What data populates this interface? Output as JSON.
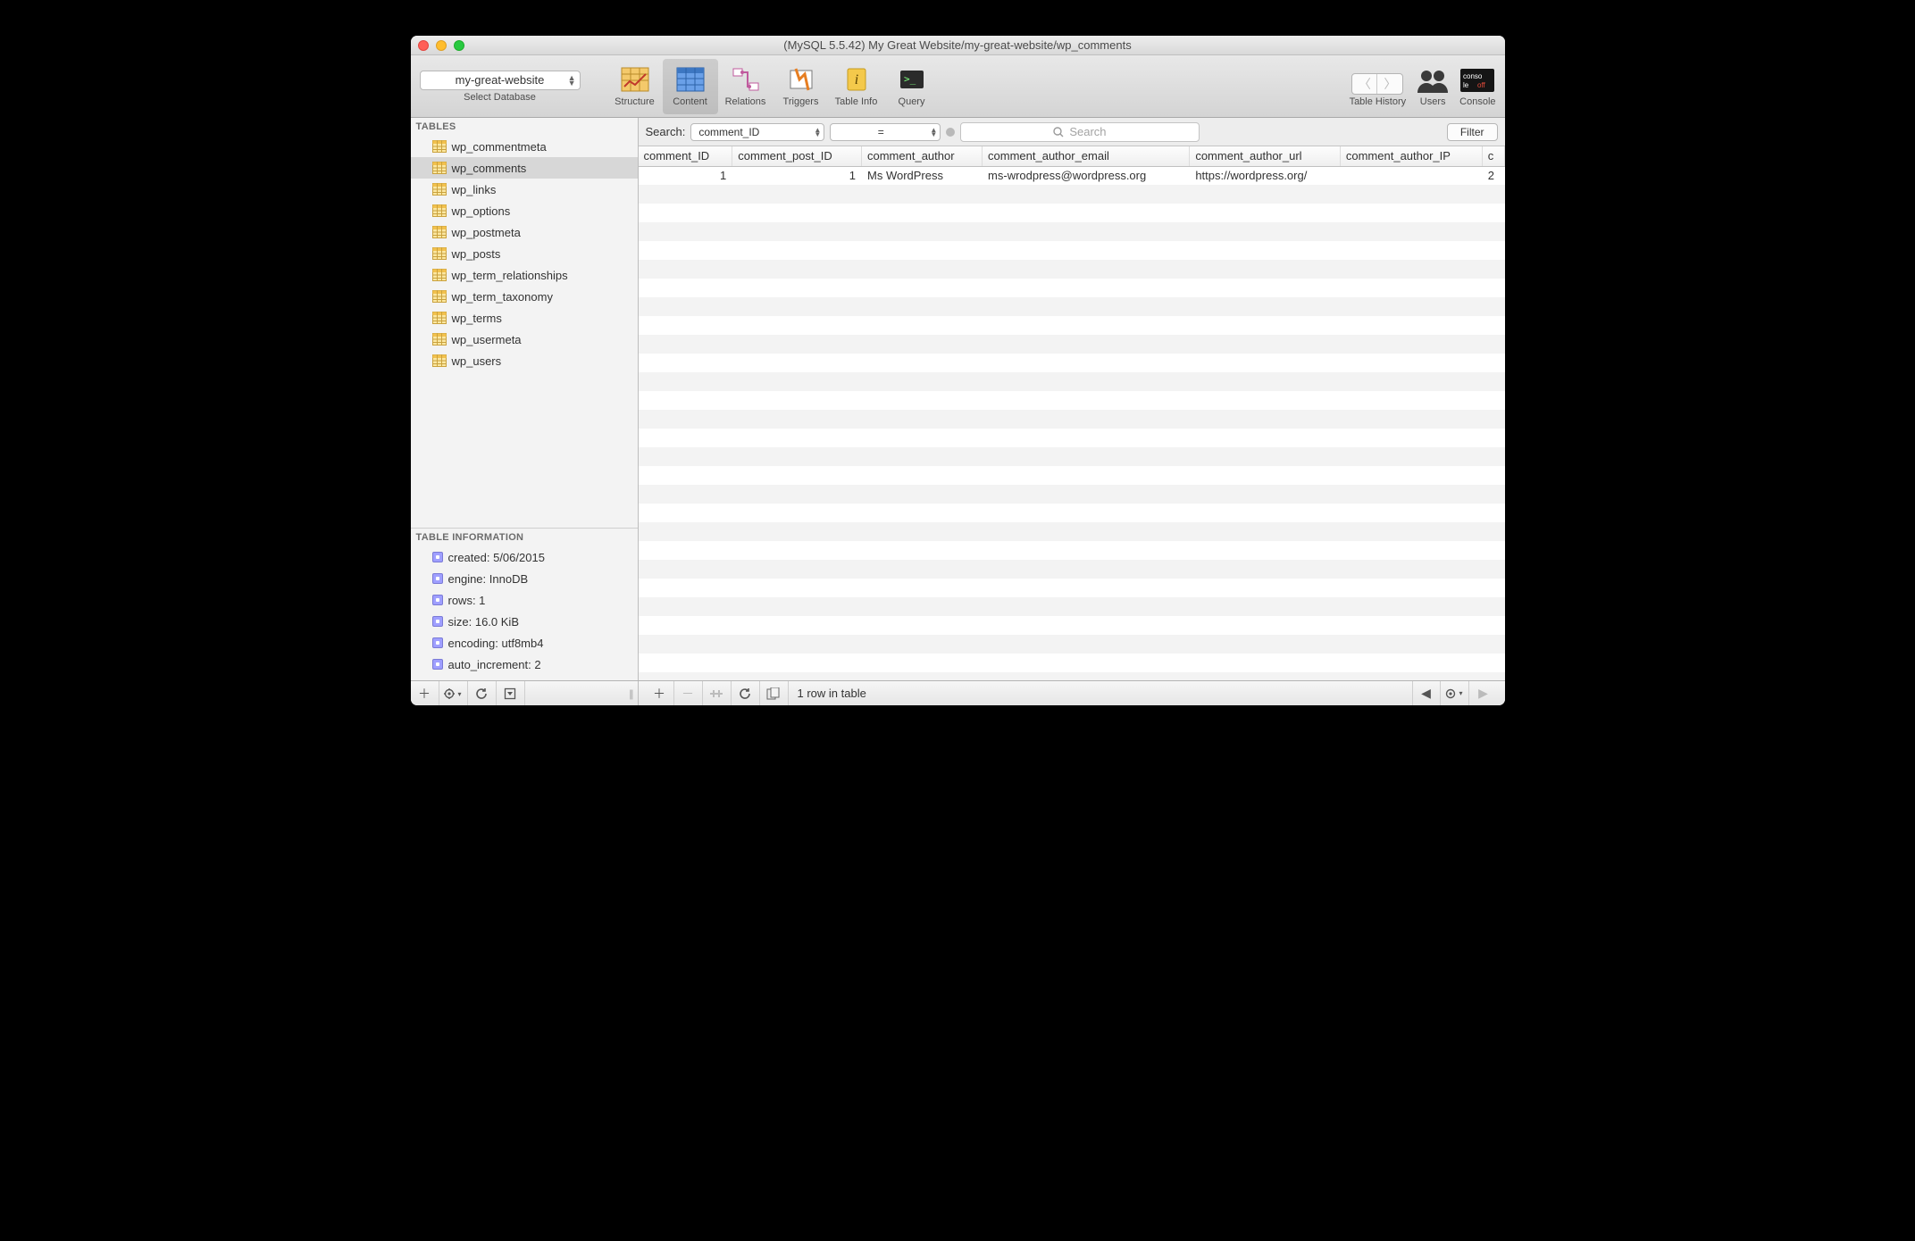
{
  "window": {
    "title": "(MySQL 5.5.42) My Great Website/my-great-website/wp_comments"
  },
  "toolbar": {
    "database": "my-great-website",
    "select_db_label": "Select Database",
    "tabs": {
      "structure": "Structure",
      "content": "Content",
      "relations": "Relations",
      "triggers": "Triggers",
      "table_info": "Table Info",
      "query": "Query"
    },
    "history_wrap_label": "Table History",
    "users_label": "Users",
    "console_label": "Console"
  },
  "sidebar": {
    "tables_header": "TABLES",
    "tables": [
      "wp_commentmeta",
      "wp_comments",
      "wp_links",
      "wp_options",
      "wp_postmeta",
      "wp_posts",
      "wp_term_relationships",
      "wp_term_taxonomy",
      "wp_terms",
      "wp_usermeta",
      "wp_users"
    ],
    "selected_table": "wp_comments",
    "info_header": "TABLE INFORMATION",
    "info": [
      "created: 5/06/2015",
      "engine: InnoDB",
      "rows: 1",
      "size: 16.0 KiB",
      "encoding: utf8mb4",
      "auto_increment: 2"
    ]
  },
  "search": {
    "label": "Search:",
    "field": "comment_ID",
    "operator": "=",
    "placeholder": "Search",
    "filter_label": "Filter"
  },
  "grid": {
    "columns": [
      "comment_ID",
      "comment_post_ID",
      "comment_author",
      "comment_author_email",
      "comment_author_url",
      "comment_author_IP",
      "c"
    ],
    "numeric_cols": [
      "comment_ID",
      "comment_post_ID"
    ],
    "rows": [
      {
        "comment_ID": "1",
        "comment_post_ID": "1",
        "comment_author": "Ms WordPress",
        "comment_author_email": "ms-wrodpress@wordpress.org",
        "comment_author_url": "https://wordpress.org/",
        "comment_author_IP": "",
        "c": "2"
      }
    ]
  },
  "status": {
    "row_count": "1 row in table"
  }
}
